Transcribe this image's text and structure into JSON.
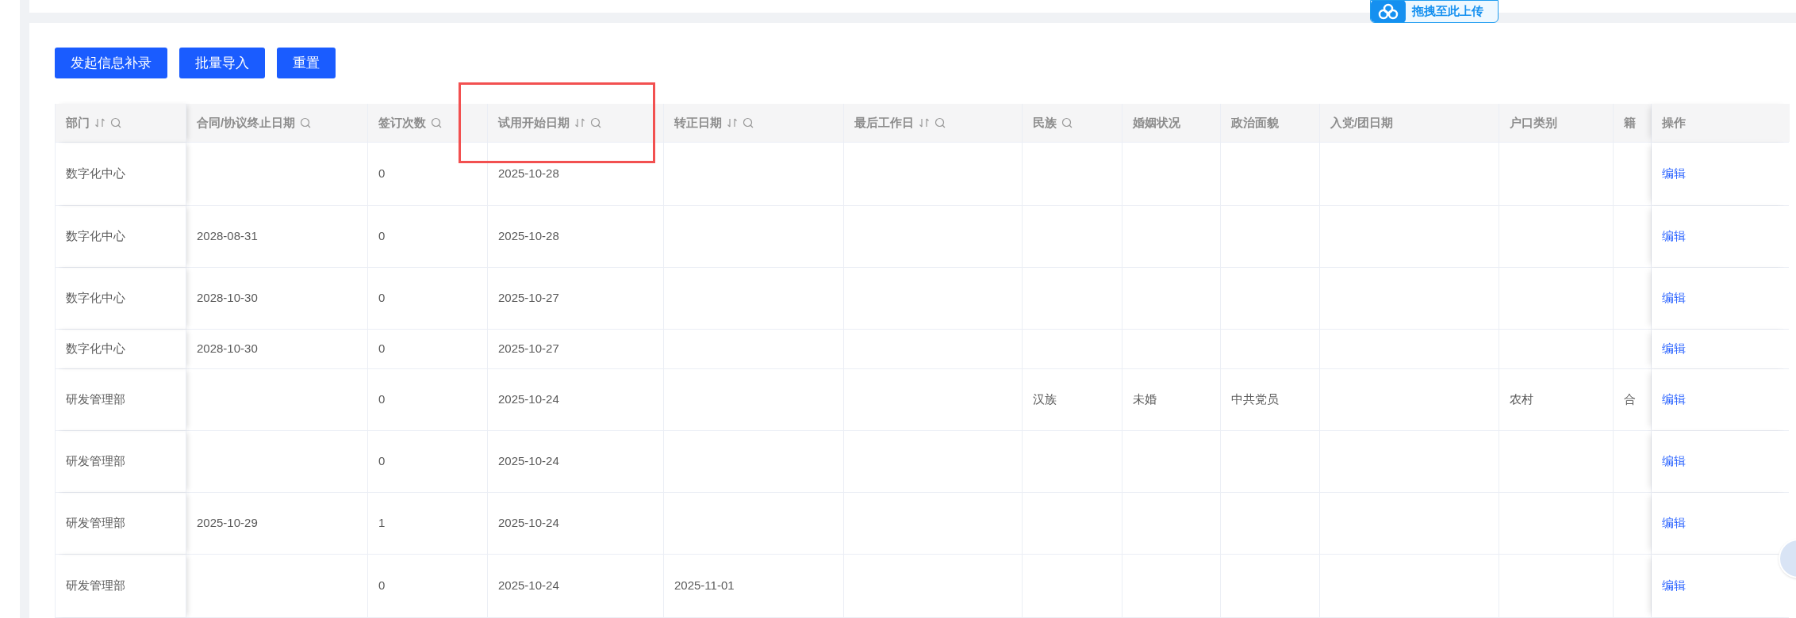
{
  "buttons": [
    {
      "label": "发起信息补录"
    },
    {
      "label": "批量导入"
    },
    {
      "label": "重置"
    }
  ],
  "upload_hint": {
    "label": "拖拽至此上传"
  },
  "table": {
    "columns": [
      {
        "label": "部门",
        "sortable": true,
        "searchable": true
      },
      {
        "label": "合同/协议终止日期",
        "sortable": false,
        "searchable": true
      },
      {
        "label": "签订次数",
        "sortable": false,
        "searchable": true
      },
      {
        "label": "试用开始日期",
        "sortable": true,
        "searchable": true,
        "highlighted": true
      },
      {
        "label": "转正日期",
        "sortable": true,
        "searchable": true
      },
      {
        "label": "最后工作日",
        "sortable": true,
        "searchable": true
      },
      {
        "label": "民族",
        "sortable": false,
        "searchable": true
      },
      {
        "label": "婚姻状况",
        "sortable": false,
        "searchable": false
      },
      {
        "label": "政治面貌",
        "sortable": false,
        "searchable": false
      },
      {
        "label": "入党/团日期",
        "sortable": false,
        "searchable": false
      },
      {
        "label": "户口类别",
        "sortable": false,
        "searchable": false
      },
      {
        "label": "籍",
        "sortable": false,
        "searchable": false
      },
      {
        "label": "操作",
        "sortable": false,
        "searchable": false
      }
    ],
    "rows": [
      {
        "cells": [
          "数字化中心",
          null,
          "0",
          "2025-10-28",
          null,
          null,
          null,
          null,
          null,
          null,
          null,
          null
        ],
        "action": "编辑"
      },
      {
        "cells": [
          "数字化中心",
          "2028-08-31",
          "0",
          "2025-10-28",
          null,
          null,
          null,
          null,
          null,
          null,
          null,
          null
        ],
        "action": "编辑"
      },
      {
        "cells": [
          "数字化中心",
          "2028-10-30",
          "0",
          "2025-10-27",
          null,
          null,
          null,
          null,
          null,
          null,
          null,
          null
        ],
        "action": "编辑"
      },
      {
        "cells": [
          "数字化中心",
          "2028-10-30",
          "0",
          "2025-10-27",
          null,
          null,
          null,
          null,
          null,
          null,
          null,
          null
        ],
        "action": "编辑"
      },
      {
        "cells": [
          "研发管理部",
          null,
          "0",
          "2025-10-24",
          null,
          null,
          "汉族",
          "未婚",
          "中共党员",
          null,
          "农村",
          "合"
        ],
        "action": "编辑"
      },
      {
        "cells": [
          "研发管理部",
          null,
          "0",
          "2025-10-24",
          null,
          null,
          null,
          null,
          null,
          null,
          null,
          null
        ],
        "action": "编辑"
      },
      {
        "cells": [
          "研发管理部",
          "2025-10-29",
          "1",
          "2025-10-24",
          null,
          null,
          null,
          null,
          null,
          null,
          null,
          null
        ],
        "action": "编辑"
      },
      {
        "cells": [
          "研发管理部",
          null,
          "0",
          "2025-10-24",
          "2025-11-01",
          null,
          null,
          null,
          null,
          null,
          null,
          null
        ],
        "action": "编辑"
      }
    ]
  }
}
